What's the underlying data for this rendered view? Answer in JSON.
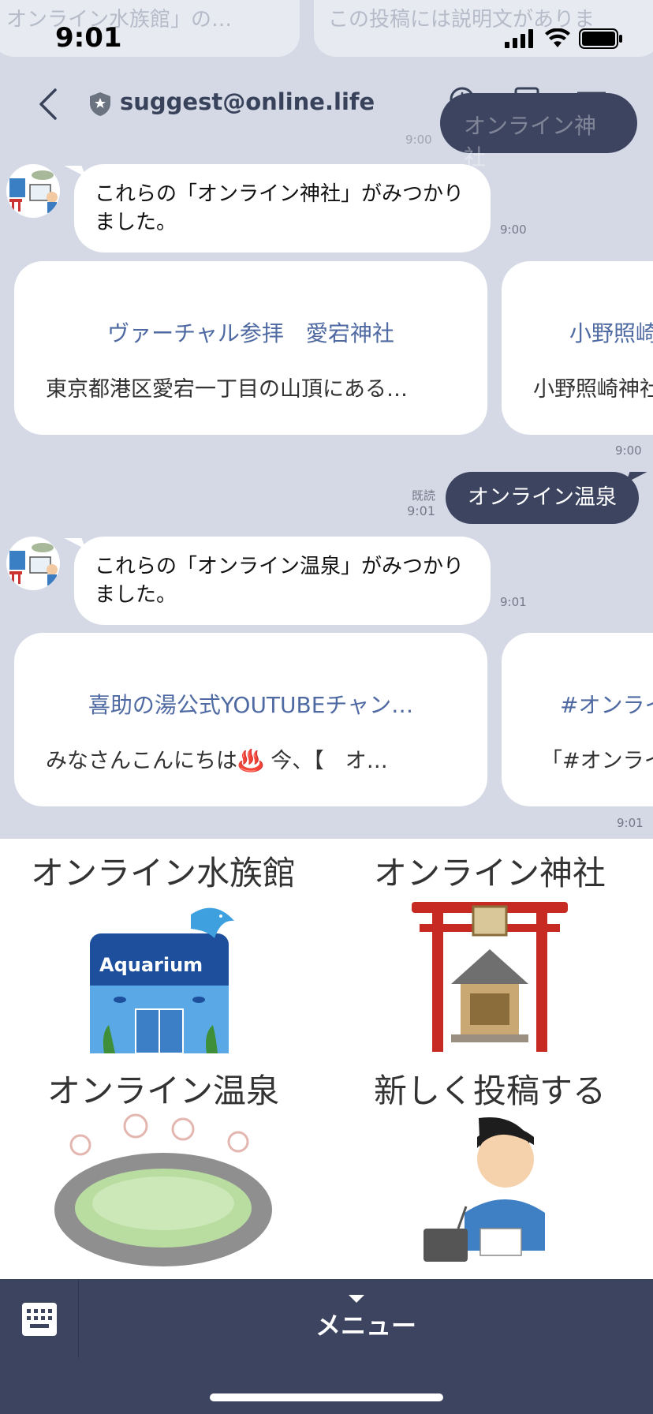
{
  "background_text": {
    "left": "オンライン水族館」の…",
    "right": "この投稿には説明文がありま",
    "prev_bubble": "オンライン神社",
    "prev_time": "9:00"
  },
  "status": {
    "time": "9:01"
  },
  "header": {
    "title": "suggest@online.life"
  },
  "messages": [
    {
      "type": "incoming",
      "text": "これらの「オンライン神社」がみつかりました。",
      "time": "9:00"
    },
    {
      "type": "carousel",
      "time": "9:00",
      "cards": [
        {
          "title": "ヴァーチャル参拝　愛宕神社",
          "desc": "東京都港区愛宕一丁目の山頂にある…"
        },
        {
          "title": "小野照崎神社",
          "desc": "小野照崎神社"
        }
      ]
    },
    {
      "type": "outgoing",
      "text": "オンライン温泉",
      "read": "既読",
      "time": "9:01"
    },
    {
      "type": "incoming",
      "text": "これらの「オンライン温泉」がみつかりました。",
      "time": "9:01"
    },
    {
      "type": "carousel",
      "time": "9:01",
      "cards": [
        {
          "title": "喜助の湯公式YOUTUBEチャン…",
          "desc": "みなさんこんにちは♨️ 今、【　オ…"
        },
        {
          "title": "#オンライン",
          "desc": "「#オンライ"
        }
      ]
    }
  ],
  "rich_menu": {
    "items": [
      {
        "label": "オンライン水族館",
        "art_text": "Aquarium"
      },
      {
        "label": "オンライン神社"
      },
      {
        "label": "オンライン温泉"
      },
      {
        "label": "新しく投稿する"
      }
    ]
  },
  "bottom_bar": {
    "menu_label": "メニュー"
  },
  "colors": {
    "chat_bg": "#d5d9e5",
    "outgoing_bubble": "#3c4460",
    "card_title": "#4f6aa2",
    "bottom_bar": "#3c4460"
  }
}
